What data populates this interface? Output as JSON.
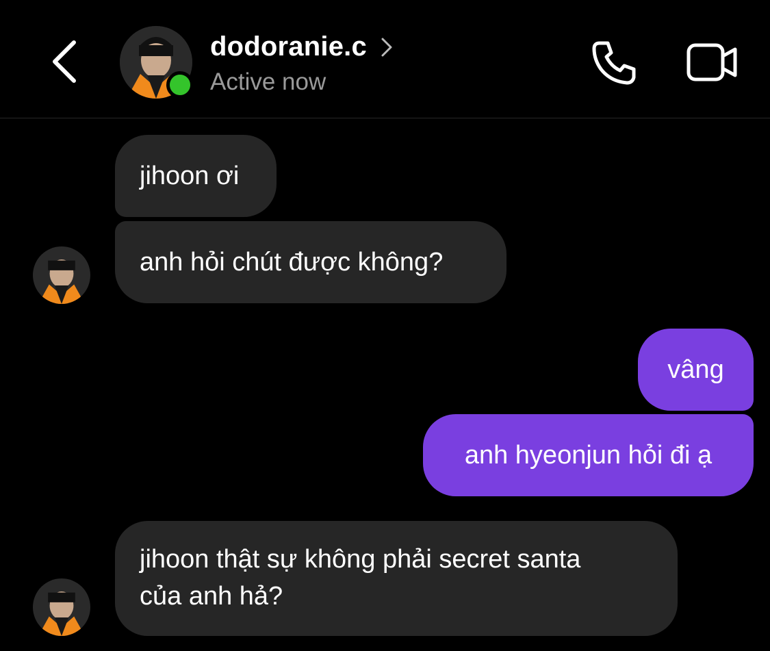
{
  "header": {
    "username": "dodoranie.c",
    "status": "Active now",
    "icons": {
      "back": "chevron-left-icon",
      "profile_chevron": "chevron-right-icon",
      "call": "phone-icon",
      "video": "video-camera-icon"
    },
    "online_color": "#34c42b"
  },
  "messages": [
    {
      "from": "them",
      "text": "jihoon ơi"
    },
    {
      "from": "them",
      "text": "anh hỏi chút được không?"
    },
    {
      "from": "me",
      "text": "vâng"
    },
    {
      "from": "me",
      "text": "anh hyeonjun hỏi đi ạ"
    },
    {
      "from": "them",
      "lines": [
        "jihoon thật sự không phải secret santa",
        "của anh hả?"
      ]
    }
  ],
  "colors": {
    "incoming_bubble": "#262626",
    "outgoing_bubble": "#7a3fe0",
    "background": "#000000"
  }
}
